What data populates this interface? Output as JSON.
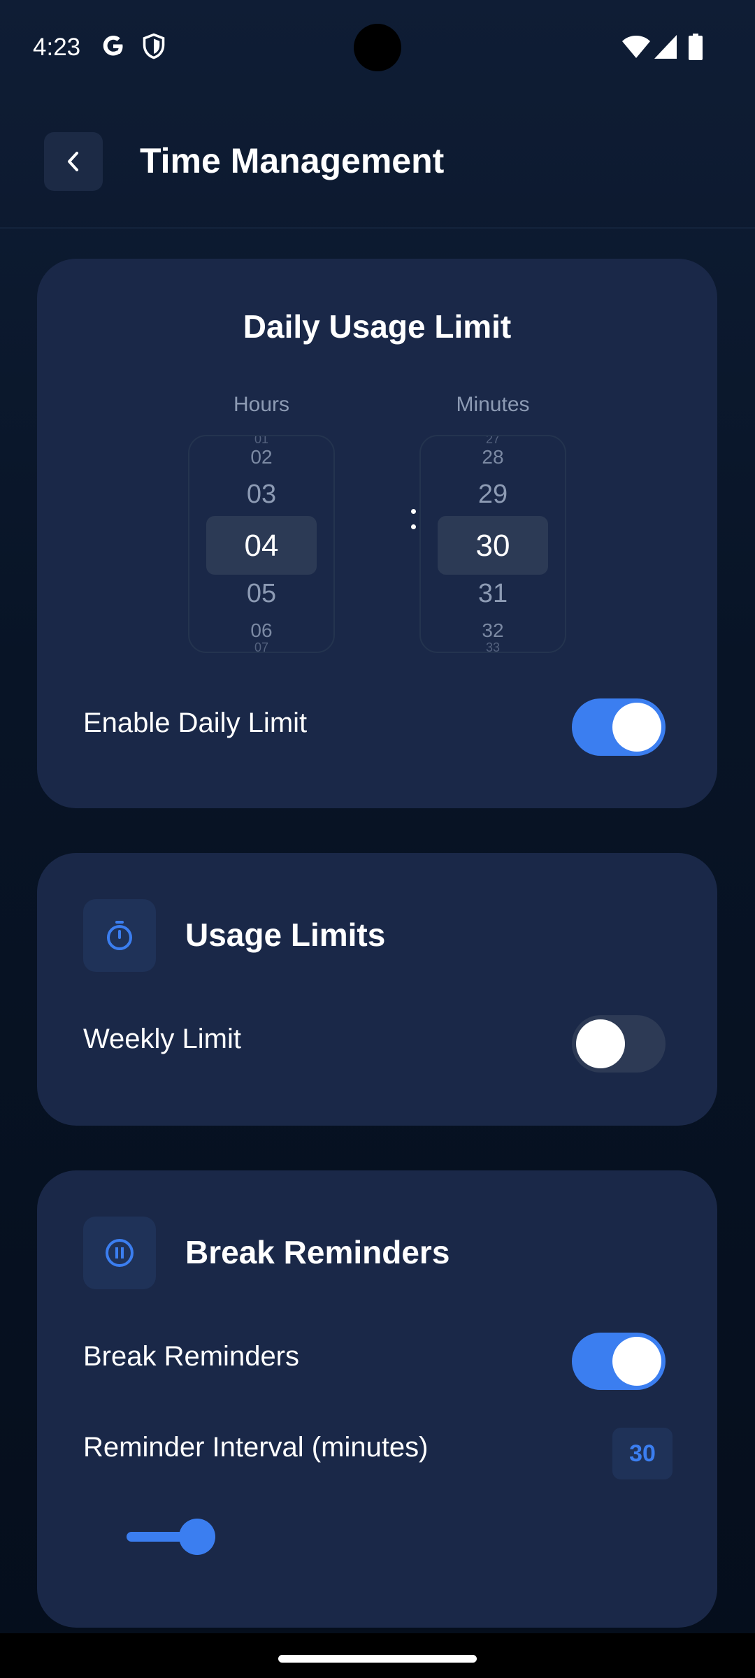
{
  "status_bar": {
    "time": "4:23",
    "icons": [
      "google-icon",
      "shield-icon",
      "wifi-icon",
      "signal-icon",
      "battery-icon"
    ]
  },
  "app_bar": {
    "title": "Time Management",
    "back_icon": "chevron-left-icon"
  },
  "daily_usage": {
    "title": "Daily Usage Limit",
    "hours_label": "Hours",
    "minutes_label": "Minutes",
    "separator": ":",
    "hours_picker": {
      "tiny_top": "01",
      "far_top": "02",
      "near_top": "03",
      "selected": "04",
      "near_bottom": "05",
      "far_bottom": "06",
      "tiny_bottom": "07"
    },
    "minutes_picker": {
      "tiny_top": "27",
      "far_top": "28",
      "near_top": "29",
      "selected": "30",
      "near_bottom": "31",
      "far_bottom": "32",
      "tiny_bottom": "33"
    },
    "enable_label": "Enable Daily Limit",
    "enable_on": true
  },
  "usage_limits": {
    "title": "Usage Limits",
    "icon": "timer-icon",
    "weekly_label": "Weekly Limit",
    "weekly_on": false
  },
  "break_reminders": {
    "title": "Break Reminders",
    "icon": "pause-icon",
    "toggle_label": "Break Reminders",
    "toggle_on": true,
    "interval_label": "Reminder Interval (minutes)",
    "interval_value": "30"
  },
  "colors": {
    "accent": "#3b7ef0",
    "card": "#1a2848",
    "background": "#081426"
  }
}
